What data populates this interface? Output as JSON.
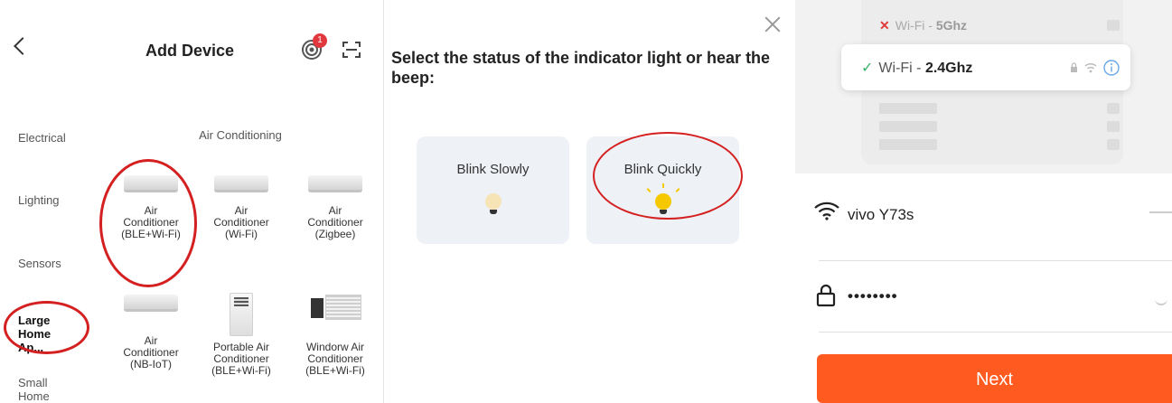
{
  "add_device": {
    "title": "Add Device",
    "badge_count": "1",
    "categories": [
      "Electrical",
      "Lighting",
      "Sensors",
      "Large Home Ap...",
      "Small Home Ap..."
    ],
    "active_category": "Large Home Ap...",
    "subheading": "Air Conditioning",
    "devices": [
      {
        "line1": "Air",
        "line2": "Conditioner",
        "line3": "(BLE+Wi-Fi)"
      },
      {
        "line1": "Air",
        "line2": "Conditioner",
        "line3": "(Wi-Fi)"
      },
      {
        "line1": "Air",
        "line2": "Conditioner",
        "line3": "(Zigbee)"
      },
      {
        "line1": "Air",
        "line2": "Conditioner",
        "line3": "(NB-IoT)"
      },
      {
        "line1": "Portable Air",
        "line2": "Conditioner",
        "line3": "(BLE+Wi-Fi)"
      },
      {
        "line1": "Windorw Air",
        "line2": "Conditioner",
        "line3": "(BLE+Wi-Fi)"
      }
    ]
  },
  "indicator": {
    "question": "Select the status of the indicator light or hear the beep:",
    "options": [
      "Blink Slowly",
      "Blink Quickly"
    ]
  },
  "wifi": {
    "band_5g_prefix": "Wi-Fi - ",
    "band_5g": "5Ghz",
    "band_24g_prefix": "Wi-Fi - ",
    "band_24g": "2.4Ghz",
    "ssid": "vivo Y73s",
    "password": "••••••••",
    "next_label": "Next"
  },
  "colors": {
    "accent": "#ff5a1f",
    "highlight": "#d42020",
    "bulb_on": "#f5c800",
    "check": "#36b36a"
  }
}
